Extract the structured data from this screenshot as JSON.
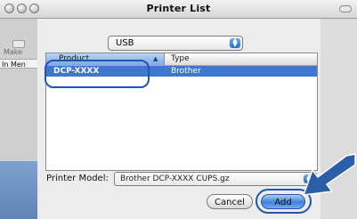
{
  "window": {
    "title": "Printer List"
  },
  "sidebar": {
    "make_label": "Make",
    "in_menu_label": "In Men"
  },
  "connection": {
    "selected": "USB"
  },
  "printer_table": {
    "columns": {
      "product": "Product",
      "type": "Type"
    },
    "rows": [
      {
        "product": "DCP-XXXX",
        "type": "Brother"
      }
    ]
  },
  "model": {
    "label": "Printer Model:",
    "value": "Brother DCP-XXXX CUPS.gz"
  },
  "buttons": {
    "cancel": "Cancel",
    "add": "Add"
  },
  "colors": {
    "accent": "#3d77d2",
    "callout": "#1e56b0",
    "arrow": "#2a5fa8"
  }
}
